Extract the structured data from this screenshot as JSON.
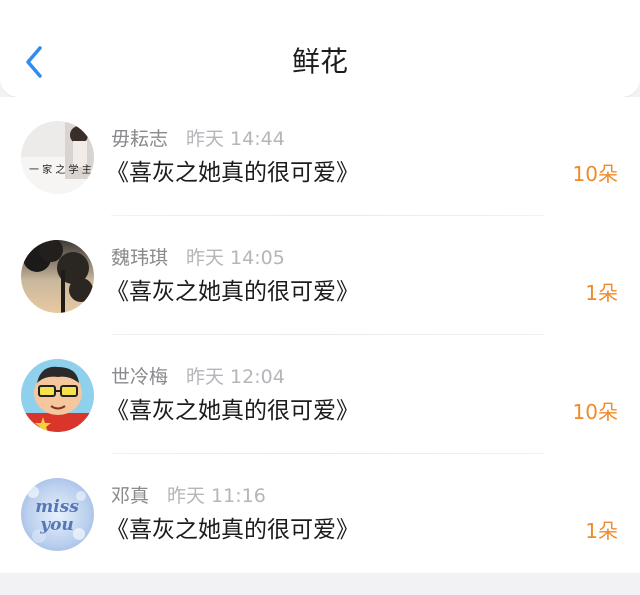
{
  "header": {
    "title": "鲜花",
    "back_icon": "chevron-left-icon",
    "accent": "#2f8cf0"
  },
  "items": [
    {
      "name": "毋耘志",
      "time": "昨天 14:44",
      "post": "《喜灰之她真的很可爱》",
      "count": "10朵",
      "avatar": "calligraphy-photo"
    },
    {
      "name": "魏玮琪",
      "time": "昨天 14:05",
      "post": "《喜灰之她真的很可爱》",
      "count": "1朵",
      "avatar": "sunset-trees-photo"
    },
    {
      "name": "世冷梅",
      "time": "昨天 12:04",
      "post": "《喜灰之她真的很可爱》",
      "count": "10朵",
      "avatar": "cartoon-boy-glasses"
    },
    {
      "name": "邓真",
      "time": "昨天 11:16",
      "post": "《喜灰之她真的很可爱》",
      "count": "1朵",
      "avatar": "miss-you-bokeh"
    }
  ],
  "colors": {
    "count": "#f08a2a",
    "title": "#1c1c1e",
    "meta": "#8e8e93"
  }
}
